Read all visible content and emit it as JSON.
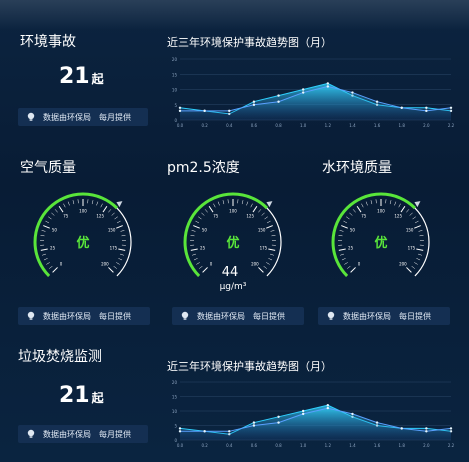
{
  "accident": {
    "title": "环境事故",
    "count": "21",
    "unit": "起",
    "chart_title": "近三年环境保护事故趋势图（月）",
    "source": {
      "label": "数据由环保局",
      "freq": "每月提供"
    }
  },
  "air": {
    "title": "空气质量",
    "grade": "优",
    "source": {
      "label": "数据由环保局",
      "freq": "每日提供"
    }
  },
  "pm25": {
    "title": "pm2.5浓度",
    "grade": "优",
    "value": "44",
    "unit": "μg/m³",
    "source": {
      "label": "数据由环保局",
      "freq": "每日提供"
    }
  },
  "water": {
    "title": "水环境质量",
    "grade": "优",
    "source": {
      "label": "数据由环保局",
      "freq": "每日提供"
    }
  },
  "waste": {
    "title": "垃圾焚烧监测",
    "count": "21",
    "unit": "起",
    "chart_title": "近三年环境保护事故趋势图（月）",
    "source": {
      "label": "数据由环保局",
      "freq": "每月提供"
    }
  },
  "colors": {
    "accent_green": "#59e53a",
    "line_cyan": "#2fd0ff",
    "panel": "#142f52"
  },
  "chart_data": [
    {
      "type": "area",
      "title": "近三年环境保护事故趋势图（月）",
      "xlabel": "",
      "ylabel": "",
      "x": [
        0,
        1,
        2,
        3,
        4,
        5,
        6,
        7,
        8,
        9,
        10,
        11
      ],
      "x_ticks": [
        "0.0",
        "0.2",
        "0.4",
        "0.6",
        "0.8",
        "1.0",
        "1.2",
        "1.4",
        "1.6",
        "1.8",
        "2.0",
        "2.2"
      ],
      "y_ticks": [
        "0",
        "5",
        "10",
        "15",
        "20"
      ],
      "ylim": [
        0,
        20
      ],
      "series": [
        {
          "values": [
            4,
            3,
            2,
            6,
            8,
            10,
            12,
            8,
            5,
            4,
            4,
            3
          ]
        },
        {
          "values": [
            3,
            3,
            3,
            5,
            6,
            9,
            11,
            9,
            6,
            4,
            3,
            4
          ]
        }
      ]
    },
    {
      "type": "area",
      "title": "近三年环境保护事故趋势图（月）",
      "xlabel": "",
      "ylabel": "",
      "x": [
        0,
        1,
        2,
        3,
        4,
        5,
        6,
        7,
        8,
        9,
        10,
        11
      ],
      "x_ticks": [
        "0.0",
        "0.2",
        "0.4",
        "0.6",
        "0.8",
        "1.0",
        "1.2",
        "1.4",
        "1.6",
        "1.8",
        "2.0",
        "2.2"
      ],
      "y_ticks": [
        "0",
        "5",
        "10",
        "15",
        "20"
      ],
      "ylim": [
        0,
        20
      ],
      "series": [
        {
          "values": [
            4,
            3,
            2,
            6,
            8,
            10,
            12,
            8,
            5,
            4,
            4,
            3
          ]
        },
        {
          "values": [
            3,
            3,
            3,
            5,
            6,
            9,
            11,
            9,
            6,
            4,
            3,
            4
          ]
        }
      ]
    }
  ]
}
